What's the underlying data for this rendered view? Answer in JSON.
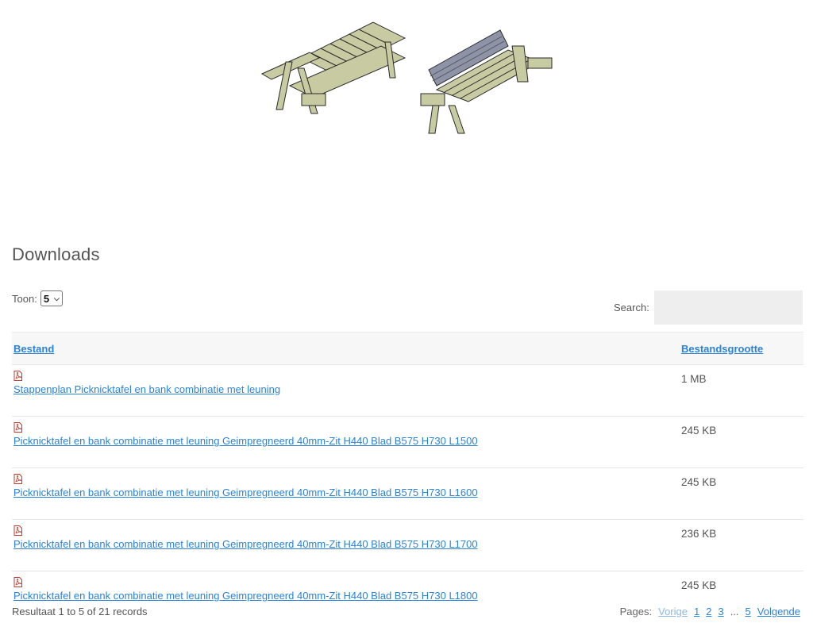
{
  "hero": {
    "image_name": "picnic-table-bench-illustration"
  },
  "section": {
    "title": "Downloads"
  },
  "controls": {
    "show_label": "Toon:",
    "show_value": "5",
    "search_label": "Search:",
    "search_value": ""
  },
  "table": {
    "headers": {
      "file": "Bestand",
      "size": "Bestandsgrootte"
    },
    "rows": [
      {
        "name": "Stappenplan Picknicktafel en bank combinatie met leuning",
        "size": "1 MB"
      },
      {
        "name": "Picknicktafel en bank combinatie met leuning Geimpregneerd 40mm-Zit H440 Blad B575 H730 L1500",
        "size": "245 KB"
      },
      {
        "name": "Picknicktafel en bank combinatie met leuning Geimpregneerd 40mm-Zit H440 Blad B575 H730 L1600",
        "size": "245 KB"
      },
      {
        "name": "Picknicktafel en bank combinatie met leuning Geimpregneerd 40mm-Zit H440 Blad B575 H730 L1700",
        "size": "236 KB"
      },
      {
        "name": "Picknicktafel en bank combinatie met leuning Geimpregneerd 40mm-Zit H440 Blad B575 H730 L1800",
        "size": "245 KB"
      }
    ]
  },
  "footer": {
    "result_text": "Resultaat 1 to 5 of 21 records",
    "pages_label": "Pages:",
    "prev": "Vorige",
    "pages": [
      "1",
      "2",
      "3"
    ],
    "ellipsis": "...",
    "last_page": "5",
    "next": "Volgende"
  },
  "colors": {
    "link": "#2a83d8",
    "header_bg": "#f7f7f7",
    "search_bg": "#eeeeee",
    "pdf": "#c0392b"
  }
}
